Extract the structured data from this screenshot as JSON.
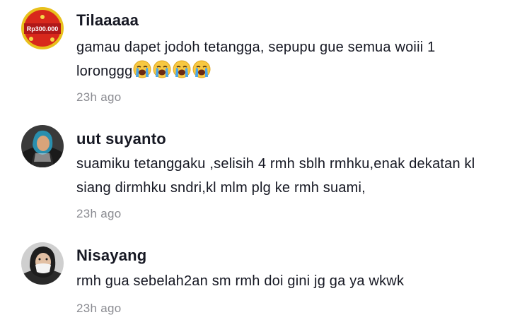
{
  "comments": [
    {
      "avatar_badge": "Rp300.000",
      "username": "Tilaaaaa",
      "text": "gamau dapet jodoh tetangga, sepupu gue semua woiii 1 loronggg",
      "emojis": [
        "loudly-crying-face",
        "loudly-crying-face",
        "loudly-crying-face",
        "loudly-crying-face"
      ],
      "time": "23h ago"
    },
    {
      "username": "uut suyanto",
      "text": "suamiku tetanggaku ,selisih 4 rmh sblh rmhku,enak dekatan kl siang dirmhku sndri,kl mlm plg ke rmh suami,",
      "time": "23h ago"
    },
    {
      "username": "Nisayang",
      "text": "rmh gua sebelah2an sm rmh doi gini jg ga ya wkwk",
      "time": "23h ago"
    }
  ]
}
